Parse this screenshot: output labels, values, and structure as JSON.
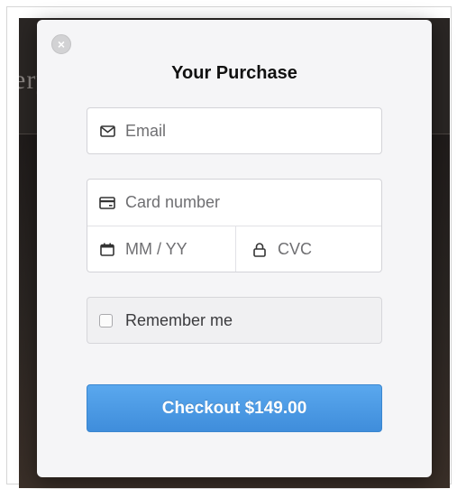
{
  "background": {
    "partial_text": "ery"
  },
  "modal": {
    "close_glyph": "×",
    "title": "Your Purchase",
    "email": {
      "placeholder": "Email",
      "icon": "envelope-icon"
    },
    "card_number": {
      "placeholder": "Card number",
      "icon": "credit-card-icon"
    },
    "expiry": {
      "placeholder": "MM / YY",
      "icon": "calendar-icon"
    },
    "cvc": {
      "placeholder": "CVC",
      "icon": "lock-icon"
    },
    "remember_me": {
      "label": "Remember me",
      "checked": false
    },
    "checkout_button": {
      "label": "Checkout $149.00"
    }
  },
  "colors": {
    "button": "#4a9be6",
    "modal_bg": "#f5f5f7",
    "backdrop": "#231f1d"
  }
}
